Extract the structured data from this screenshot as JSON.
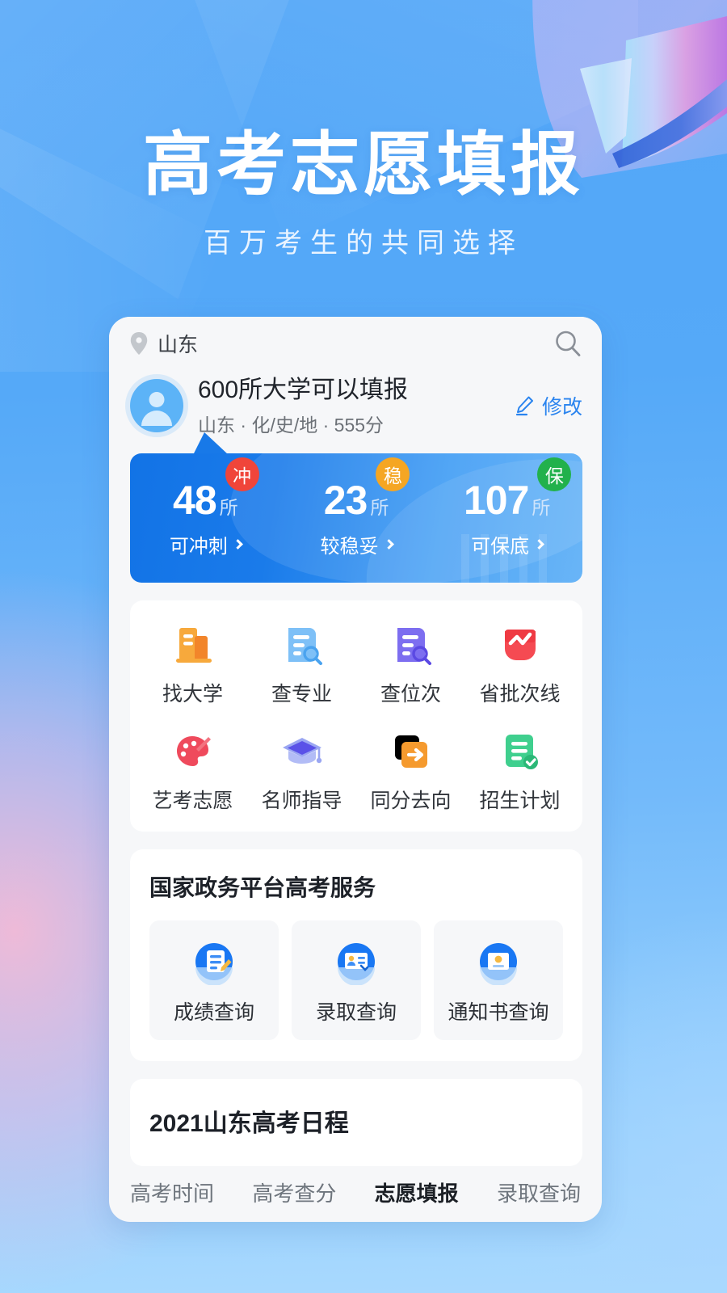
{
  "hero": {
    "title": "高考志愿填报",
    "subtitle": "百万考生的共同选择"
  },
  "colors": {
    "brand_blue": "#2a84ef",
    "banner_from": "#1273e6",
    "banner_to": "#5aaef7",
    "badge_chong": "#f0453a",
    "badge_wen": "#f5a623",
    "badge_bao": "#22b14c",
    "page_bg": "#4ea8f7",
    "card_bg": "#f6f7f9"
  },
  "search_bar": {
    "location": "山东",
    "location_icon": "location-pin-icon",
    "search_icon": "search-icon"
  },
  "profile": {
    "avatar_icon": "user-avatar-icon",
    "title": "600所大学可以填报",
    "meta": "山东 · 化/史/地 · 555分",
    "edit_label": "修改",
    "edit_icon": "pencil-edit-icon"
  },
  "stats": [
    {
      "value": "48",
      "unit": "所",
      "badge": "冲",
      "badge_color": "#f0453a",
      "link": "可冲刺"
    },
    {
      "value": "23",
      "unit": "所",
      "badge": "稳",
      "badge_color": "#f5a623",
      "link": "较稳妥"
    },
    {
      "value": "107",
      "unit": "所",
      "badge": "保",
      "badge_color": "#22b14c",
      "link": "可保底"
    }
  ],
  "grid": [
    {
      "label": "找大学",
      "icon": "building-orange-icon"
    },
    {
      "label": "查专业",
      "icon": "document-search-blue-icon"
    },
    {
      "label": "查位次",
      "icon": "document-search-purple-icon"
    },
    {
      "label": "省批次线",
      "icon": "chart-line-red-icon"
    },
    {
      "label": "艺考志愿",
      "icon": "palette-red-icon"
    },
    {
      "label": "名师指导",
      "icon": "graduation-cap-purple-icon"
    },
    {
      "label": "同分去向",
      "icon": "arrow-right-orange-icon"
    },
    {
      "label": "招生计划",
      "icon": "checklist-green-icon"
    }
  ],
  "gov": {
    "title": "国家政务平台高考服务",
    "items": [
      {
        "label": "成绩查询",
        "icon": "score-query-icon"
      },
      {
        "label": "录取查询",
        "icon": "admission-query-icon"
      },
      {
        "label": "通知书查询",
        "icon": "notice-query-icon"
      }
    ]
  },
  "schedule": {
    "title": "2021山东高考日程"
  },
  "tabs": [
    {
      "label": "高考时间",
      "active": false
    },
    {
      "label": "高考查分",
      "active": false
    },
    {
      "label": "志愿填报",
      "active": true
    },
    {
      "label": "录取查询",
      "active": false
    }
  ]
}
